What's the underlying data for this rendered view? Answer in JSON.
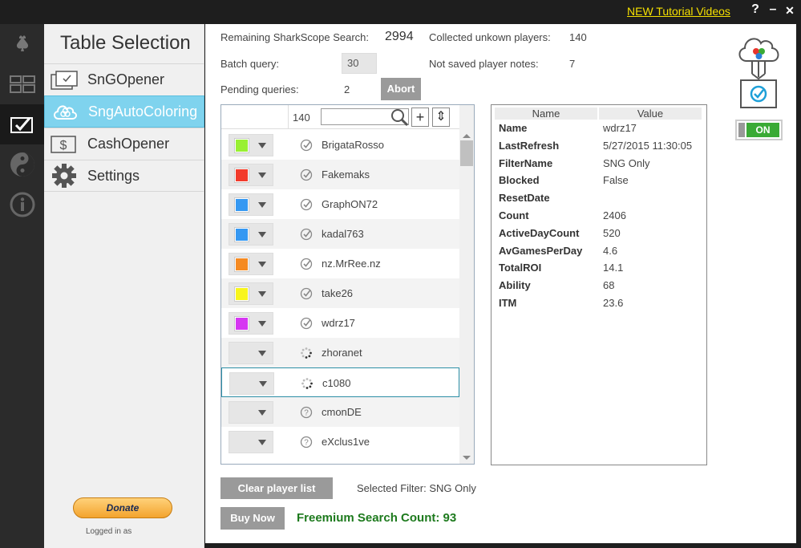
{
  "titlebar": {
    "tutorial_link": "NEW Tutorial Videos",
    "help": "?",
    "minimize": "–",
    "close": "✕"
  },
  "nav": {
    "title": "Table Selection",
    "items": [
      {
        "label": "SnGOpener",
        "icon": "sng-opener-icon"
      },
      {
        "label": "SngAutoColoring",
        "icon": "cloud-coloring-icon"
      },
      {
        "label": "CashOpener",
        "icon": "dollar-icon"
      },
      {
        "label": "Settings",
        "icon": "gear-icon"
      }
    ],
    "donate": "Donate",
    "logged_in": "Logged in as"
  },
  "stats": {
    "remaining_label": "Remaining SharkScope Search:",
    "remaining_value": "2994",
    "collected_label": "Collected unkown players:",
    "collected_value": "140",
    "batch_label": "Batch query:",
    "batch_value": "30",
    "notes_label": "Not saved player notes:",
    "notes_value": "7",
    "pending_label": "Pending queries:",
    "pending_value": "2",
    "abort": "Abort"
  },
  "list": {
    "count": "140",
    "search_placeholder": "",
    "add": "+",
    "sort": "⇕",
    "players": [
      {
        "name": "BrigataRosso",
        "color": "#99f032",
        "status": "checked"
      },
      {
        "name": "Fakemaks",
        "color": "#f23b2b",
        "status": "checked"
      },
      {
        "name": "GraphON72",
        "color": "#3598f2",
        "status": "checked"
      },
      {
        "name": "kadal763",
        "color": "#3598f2",
        "status": "checked"
      },
      {
        "name": "nz.MrRee.nz",
        "color": "#f58a22",
        "status": "checked"
      },
      {
        "name": "take26",
        "color": "#f8f51c",
        "status": "checked"
      },
      {
        "name": "wdrz17",
        "color": "#d636f2",
        "status": "checked"
      },
      {
        "name": "zhoranet",
        "color": "",
        "status": "loading"
      },
      {
        "name": "c1080",
        "color": "",
        "status": "loading"
      },
      {
        "name": "cmonDE",
        "color": "",
        "status": "unknown"
      },
      {
        "name": "eXclus1ve",
        "color": "",
        "status": "unknown"
      }
    ]
  },
  "props": {
    "col_name": "Name",
    "col_value": "Value",
    "rows": [
      {
        "name": "Name",
        "value": "wdrz17"
      },
      {
        "name": "LastRefresh",
        "value": "5/27/2015 11:30:05"
      },
      {
        "name": "FilterName",
        "value": "SNG Only"
      },
      {
        "name": "Blocked",
        "value": "False"
      },
      {
        "name": "ResetDate",
        "value": ""
      },
      {
        "name": "Count",
        "value": "2406"
      },
      {
        "name": "ActiveDayCount",
        "value": "520"
      },
      {
        "name": "AvGamesPerDay",
        "value": "4.6"
      },
      {
        "name": "TotalROI",
        "value": "14.1"
      },
      {
        "name": "Ability",
        "value": "68"
      },
      {
        "name": "ITM",
        "value": "23.6"
      }
    ]
  },
  "footer": {
    "clear": "Clear player list",
    "filter": "Selected Filter: SNG Only",
    "buy": "Buy Now",
    "freemium": "Freemium Search Count: 93"
  },
  "toggle_label": "ON"
}
